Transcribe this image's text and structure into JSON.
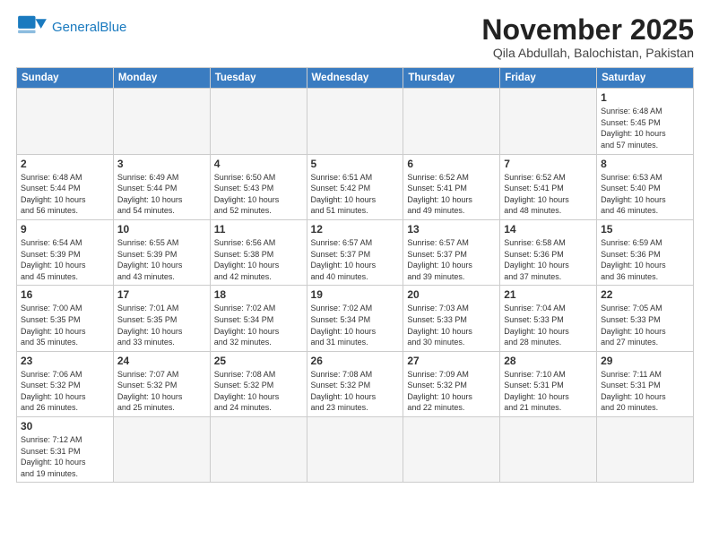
{
  "header": {
    "logo_line1": "General",
    "logo_line2": "Blue",
    "month_title": "November 2025",
    "subtitle": "Qila Abdullah, Balochistan, Pakistan"
  },
  "weekdays": [
    "Sunday",
    "Monday",
    "Tuesday",
    "Wednesday",
    "Thursday",
    "Friday",
    "Saturday"
  ],
  "days": [
    {
      "num": "",
      "info": ""
    },
    {
      "num": "",
      "info": ""
    },
    {
      "num": "",
      "info": ""
    },
    {
      "num": "",
      "info": ""
    },
    {
      "num": "",
      "info": ""
    },
    {
      "num": "",
      "info": ""
    },
    {
      "num": "1",
      "info": "Sunrise: 6:48 AM\nSunset: 5:45 PM\nDaylight: 10 hours\nand 57 minutes."
    },
    {
      "num": "2",
      "info": "Sunrise: 6:48 AM\nSunset: 5:44 PM\nDaylight: 10 hours\nand 56 minutes."
    },
    {
      "num": "3",
      "info": "Sunrise: 6:49 AM\nSunset: 5:44 PM\nDaylight: 10 hours\nand 54 minutes."
    },
    {
      "num": "4",
      "info": "Sunrise: 6:50 AM\nSunset: 5:43 PM\nDaylight: 10 hours\nand 52 minutes."
    },
    {
      "num": "5",
      "info": "Sunrise: 6:51 AM\nSunset: 5:42 PM\nDaylight: 10 hours\nand 51 minutes."
    },
    {
      "num": "6",
      "info": "Sunrise: 6:52 AM\nSunset: 5:41 PM\nDaylight: 10 hours\nand 49 minutes."
    },
    {
      "num": "7",
      "info": "Sunrise: 6:52 AM\nSunset: 5:41 PM\nDaylight: 10 hours\nand 48 minutes."
    },
    {
      "num": "8",
      "info": "Sunrise: 6:53 AM\nSunset: 5:40 PM\nDaylight: 10 hours\nand 46 minutes."
    },
    {
      "num": "9",
      "info": "Sunrise: 6:54 AM\nSunset: 5:39 PM\nDaylight: 10 hours\nand 45 minutes."
    },
    {
      "num": "10",
      "info": "Sunrise: 6:55 AM\nSunset: 5:39 PM\nDaylight: 10 hours\nand 43 minutes."
    },
    {
      "num": "11",
      "info": "Sunrise: 6:56 AM\nSunset: 5:38 PM\nDaylight: 10 hours\nand 42 minutes."
    },
    {
      "num": "12",
      "info": "Sunrise: 6:57 AM\nSunset: 5:37 PM\nDaylight: 10 hours\nand 40 minutes."
    },
    {
      "num": "13",
      "info": "Sunrise: 6:57 AM\nSunset: 5:37 PM\nDaylight: 10 hours\nand 39 minutes."
    },
    {
      "num": "14",
      "info": "Sunrise: 6:58 AM\nSunset: 5:36 PM\nDaylight: 10 hours\nand 37 minutes."
    },
    {
      "num": "15",
      "info": "Sunrise: 6:59 AM\nSunset: 5:36 PM\nDaylight: 10 hours\nand 36 minutes."
    },
    {
      "num": "16",
      "info": "Sunrise: 7:00 AM\nSunset: 5:35 PM\nDaylight: 10 hours\nand 35 minutes."
    },
    {
      "num": "17",
      "info": "Sunrise: 7:01 AM\nSunset: 5:35 PM\nDaylight: 10 hours\nand 33 minutes."
    },
    {
      "num": "18",
      "info": "Sunrise: 7:02 AM\nSunset: 5:34 PM\nDaylight: 10 hours\nand 32 minutes."
    },
    {
      "num": "19",
      "info": "Sunrise: 7:02 AM\nSunset: 5:34 PM\nDaylight: 10 hours\nand 31 minutes."
    },
    {
      "num": "20",
      "info": "Sunrise: 7:03 AM\nSunset: 5:33 PM\nDaylight: 10 hours\nand 30 minutes."
    },
    {
      "num": "21",
      "info": "Sunrise: 7:04 AM\nSunset: 5:33 PM\nDaylight: 10 hours\nand 28 minutes."
    },
    {
      "num": "22",
      "info": "Sunrise: 7:05 AM\nSunset: 5:33 PM\nDaylight: 10 hours\nand 27 minutes."
    },
    {
      "num": "23",
      "info": "Sunrise: 7:06 AM\nSunset: 5:32 PM\nDaylight: 10 hours\nand 26 minutes."
    },
    {
      "num": "24",
      "info": "Sunrise: 7:07 AM\nSunset: 5:32 PM\nDaylight: 10 hours\nand 25 minutes."
    },
    {
      "num": "25",
      "info": "Sunrise: 7:08 AM\nSunset: 5:32 PM\nDaylight: 10 hours\nand 24 minutes."
    },
    {
      "num": "26",
      "info": "Sunrise: 7:08 AM\nSunset: 5:32 PM\nDaylight: 10 hours\nand 23 minutes."
    },
    {
      "num": "27",
      "info": "Sunrise: 7:09 AM\nSunset: 5:32 PM\nDaylight: 10 hours\nand 22 minutes."
    },
    {
      "num": "28",
      "info": "Sunrise: 7:10 AM\nSunset: 5:31 PM\nDaylight: 10 hours\nand 21 minutes."
    },
    {
      "num": "29",
      "info": "Sunrise: 7:11 AM\nSunset: 5:31 PM\nDaylight: 10 hours\nand 20 minutes."
    },
    {
      "num": "30",
      "info": "Sunrise: 7:12 AM\nSunset: 5:31 PM\nDaylight: 10 hours\nand 19 minutes."
    },
    {
      "num": "",
      "info": ""
    },
    {
      "num": "",
      "info": ""
    },
    {
      "num": "",
      "info": ""
    },
    {
      "num": "",
      "info": ""
    },
    {
      "num": "",
      "info": ""
    },
    {
      "num": "",
      "info": ""
    }
  ]
}
